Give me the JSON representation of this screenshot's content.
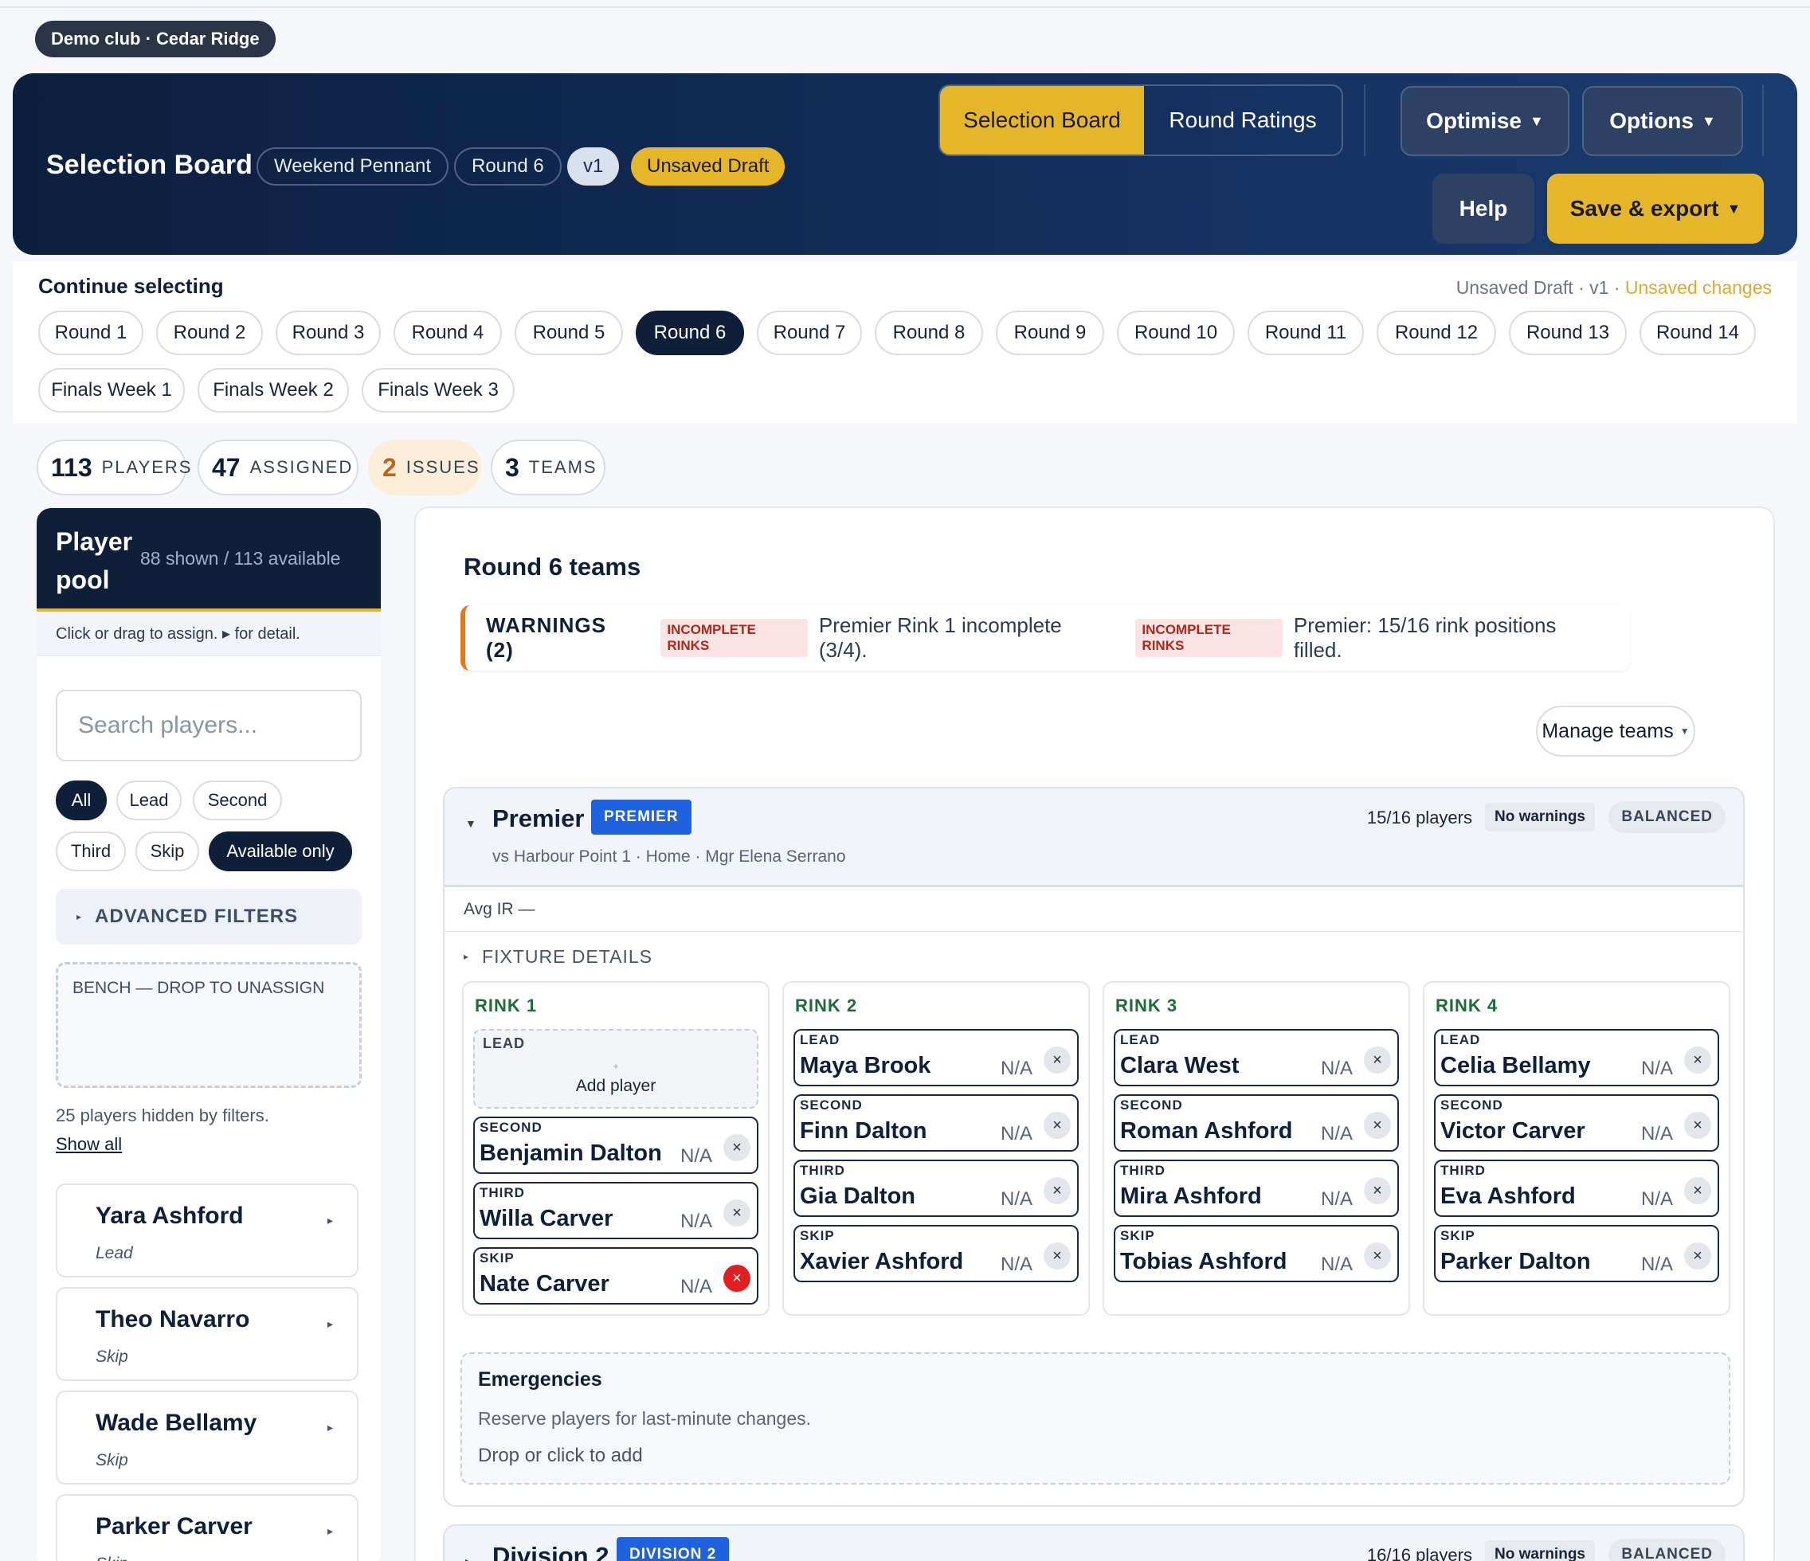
{
  "club_badge": "Demo club · Cedar Ridge",
  "header": {
    "title": "Selection Board",
    "pills": [
      "Weekend Pennant",
      "Round 6",
      "v1",
      "Unsaved Draft"
    ],
    "view_tabs": [
      "Selection Board",
      "Round Ratings"
    ],
    "optimise": "Optimise",
    "options": "Options",
    "help": "Help",
    "save": "Save & export",
    "caret": "▼"
  },
  "rounds": {
    "heading": "Continue selecting",
    "status_prefix": "Unsaved Draft · v1 · ",
    "status_changes": "Unsaved changes",
    "row1": [
      "Round 1",
      "Round 2",
      "Round 3",
      "Round 4",
      "Round 5",
      "Round 6",
      "Round 7",
      "Round 8",
      "Round 9",
      "Round 10",
      "Round 11",
      "Round 12",
      "Round 13",
      "Round 14"
    ],
    "row2": [
      "Finals Week 1",
      "Finals Week 2",
      "Finals Week 3"
    ],
    "active": "Round 6"
  },
  "stats": [
    {
      "n": "113",
      "label": "PLAYERS"
    },
    {
      "n": "47",
      "label": "ASSIGNED"
    },
    {
      "n": "2",
      "label": "ISSUES"
    },
    {
      "n": "3",
      "label": "TEAMS"
    }
  ],
  "pool": {
    "title": "Player pool",
    "subtitle": "88 shown / 113 available",
    "hint": "Click or drag to assign. ▸ for detail.",
    "search_placeholder": "Search players...",
    "filters": [
      "All",
      "Lead",
      "Second",
      "Third",
      "Skip",
      "Available only"
    ],
    "advanced": "ADVANCED FILTERS",
    "bench": "BENCH — DROP TO UNASSIGN",
    "hidden_note": "25 players hidden by filters.",
    "show_all": "Show all",
    "players": [
      {
        "name": "Yara Ashford",
        "pos": "Lead"
      },
      {
        "name": "Theo Navarro",
        "pos": "Skip"
      },
      {
        "name": "Wade Bellamy",
        "pos": "Skip"
      },
      {
        "name": "Parker Carver",
        "pos": "Skip"
      }
    ]
  },
  "main": {
    "title": "Round 6 teams",
    "warnings_title": "WARNINGS (2)",
    "warnings": [
      {
        "tag": "INCOMPLETE RINKS",
        "msg": "Premier Rink 1 incomplete (3/4)."
      },
      {
        "tag": "INCOMPLETE RINKS",
        "msg": "Premier: 15/16 rink positions filled."
      }
    ],
    "manage": "Manage teams",
    "teams": [
      {
        "name": "Premier",
        "badge": "PREMIER",
        "fixture": "vs Harbour Point 1 · Home · Mgr Elena Serrano",
        "count": "15/16 players",
        "no_warn": "No warnings",
        "balanced": "BALANCED",
        "avg": "Avg IR —",
        "fixture_details": "FIXTURE DETAILS",
        "emerg_title": "Emergencies",
        "emerg_desc": "Reserve players for last-minute changes.",
        "emerg_add": "Drop or click to add",
        "add_player": "Add player",
        "rinks": [
          {
            "label": "RINK 1",
            "slots": [
              {
                "pos": "LEAD",
                "name": "",
                "na": ""
              },
              {
                "pos": "SECOND",
                "name": "Benjamin Dalton",
                "na": "N/A"
              },
              {
                "pos": "THIRD",
                "name": "Willa Carver",
                "na": "N/A"
              },
              {
                "pos": "SKIP",
                "name": "Nate Carver",
                "na": "N/A"
              }
            ]
          },
          {
            "label": "RINK 2",
            "slots": [
              {
                "pos": "LEAD",
                "name": "Maya Brook",
                "na": "N/A"
              },
              {
                "pos": "SECOND",
                "name": "Finn Dalton",
                "na": "N/A"
              },
              {
                "pos": "THIRD",
                "name": "Gia Dalton",
                "na": "N/A"
              },
              {
                "pos": "SKIP",
                "name": "Xavier Ashford",
                "na": "N/A"
              }
            ]
          },
          {
            "label": "RINK 3",
            "slots": [
              {
                "pos": "LEAD",
                "name": "Clara West",
                "na": "N/A"
              },
              {
                "pos": "SECOND",
                "name": "Roman Ashford",
                "na": "N/A"
              },
              {
                "pos": "THIRD",
                "name": "Mira Ashford",
                "na": "N/A"
              },
              {
                "pos": "SKIP",
                "name": "Tobias Ashford",
                "na": "N/A"
              }
            ]
          },
          {
            "label": "RINK 4",
            "slots": [
              {
                "pos": "LEAD",
                "name": "Celia Bellamy",
                "na": "N/A"
              },
              {
                "pos": "SECOND",
                "name": "Victor Carver",
                "na": "N/A"
              },
              {
                "pos": "THIRD",
                "name": "Eva Ashford",
                "na": "N/A"
              },
              {
                "pos": "SKIP",
                "name": "Parker Dalton",
                "na": "N/A"
              }
            ]
          }
        ]
      },
      {
        "name": "Division 2",
        "badge": "DIVISION 2",
        "count": "16/16 players",
        "no_warn": "No warnings",
        "balanced": "BALANCED"
      }
    ]
  },
  "colors": {
    "navy": "#0f1f3a",
    "gold": "#e5b62a",
    "badge_blue": "#1f62e0",
    "warning_orange": "#e07a1a",
    "rink_green": "#1d6a3b",
    "remove_red": "#e02020"
  },
  "icons": {
    "close": "close-icon",
    "caret_right": "caret-right-icon",
    "caret_down": "caret-down-icon",
    "plus": "plus-icon"
  }
}
